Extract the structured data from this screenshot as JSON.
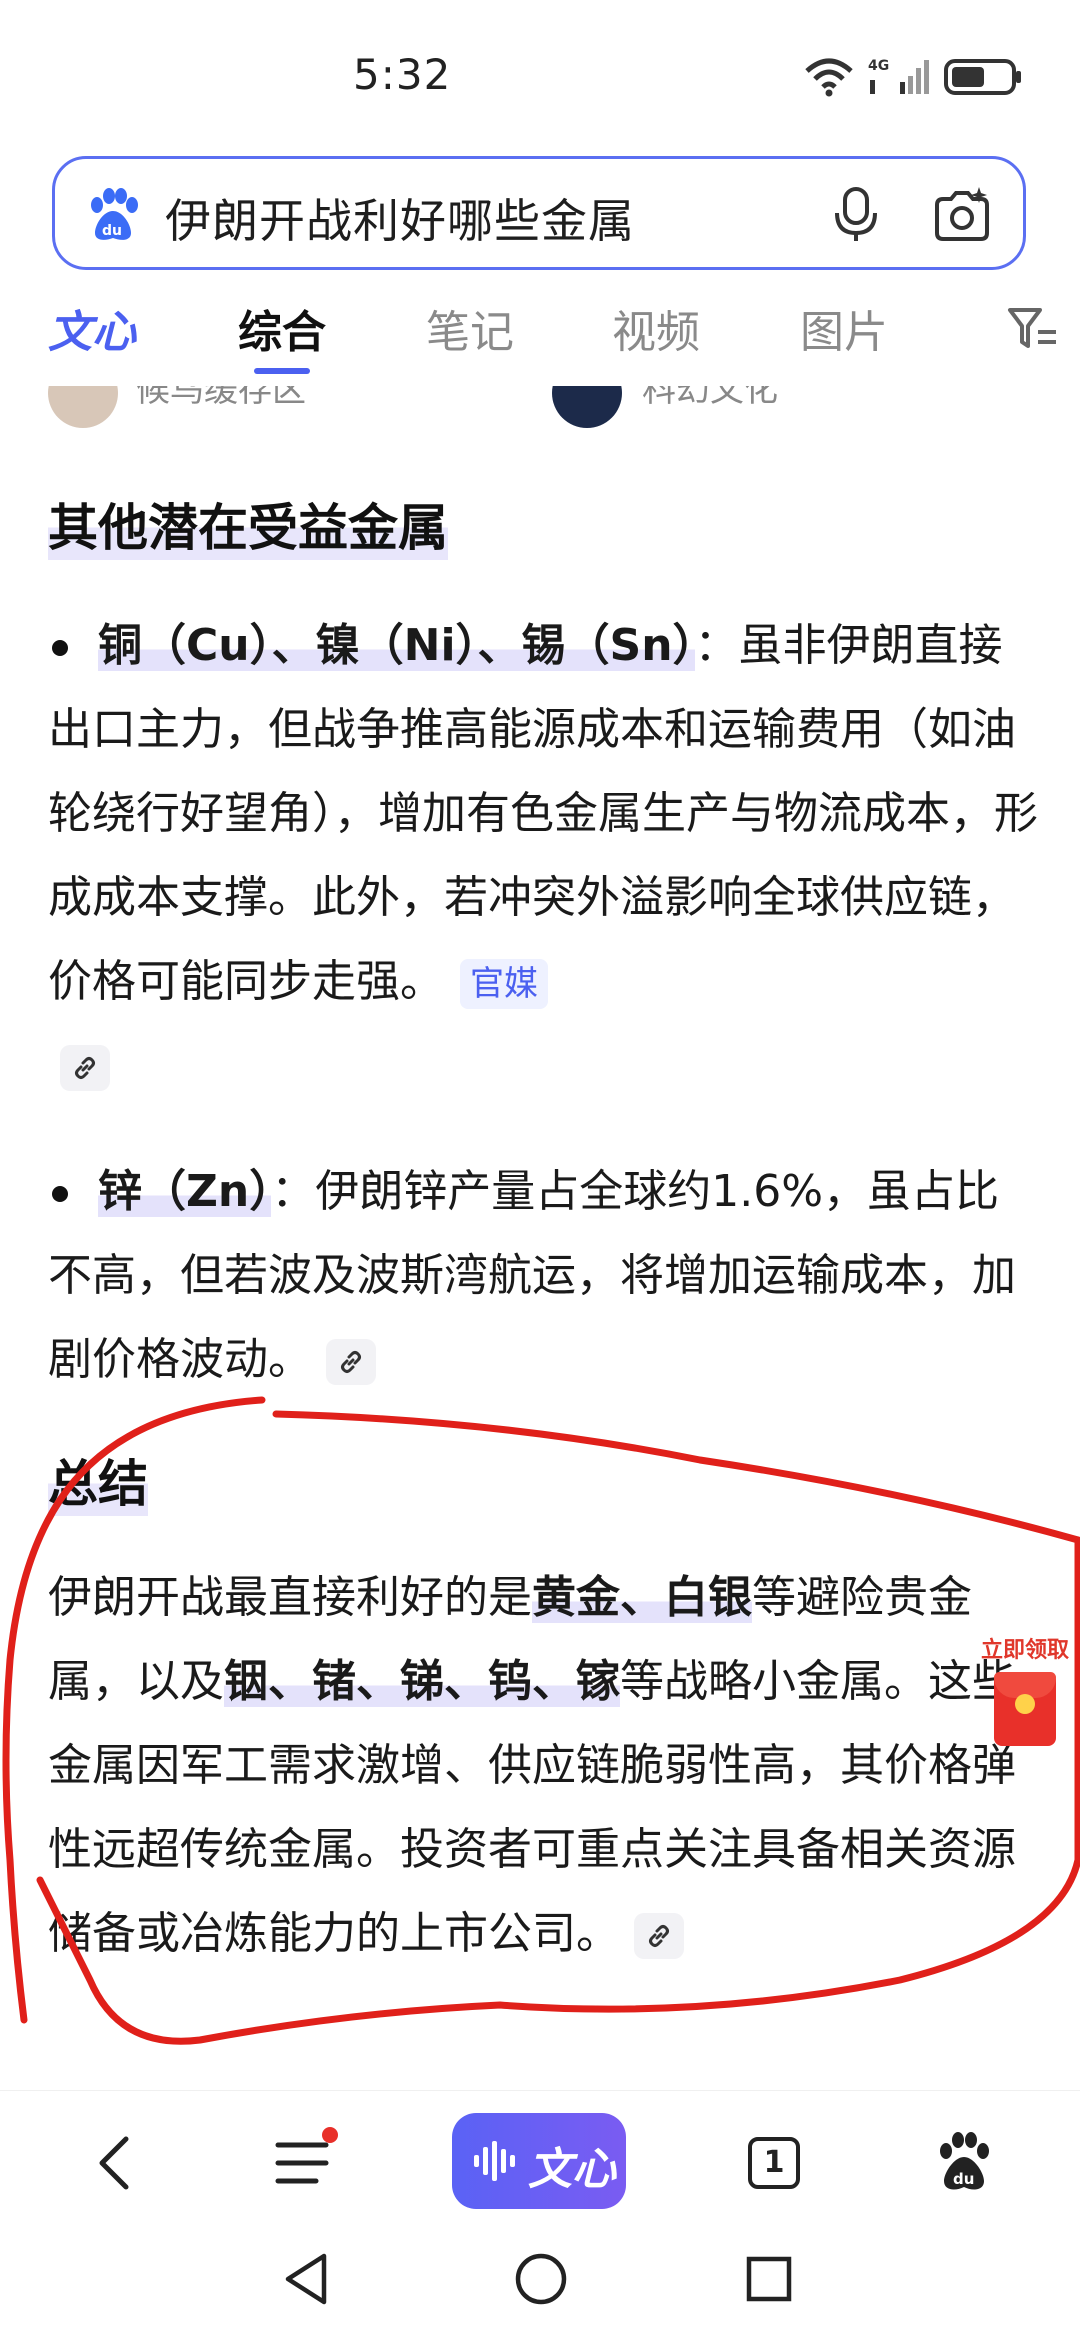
{
  "status_bar": {
    "time": "5:32",
    "network": "4G"
  },
  "search": {
    "query": "伊朗开战利好哪些金属"
  },
  "tabs": [
    {
      "label": "文心"
    },
    {
      "label": "综合"
    },
    {
      "label": "笔记"
    },
    {
      "label": "视频"
    },
    {
      "label": "图片"
    }
  ],
  "authors": [
    {
      "name": "候鸟缓存区"
    },
    {
      "name": "科幻文化"
    }
  ],
  "section1": {
    "title": "其他潜在受益金属",
    "bullet1": {
      "term": "铜（Cu）、镍（Ni）、锡（Sn）",
      "sep": "：",
      "text": "虽非伊朗直接出口主力，但战争推高能源成本和运输费用（如油轮绕行好望角），增加有色金属生产与物流成本，形成成本支撑。此外，若冲突外溢影响全球供应链，价格可能同步走强。",
      "tag": "官媒"
    },
    "bullet2": {
      "term": "锌（Zn）",
      "sep": "：",
      "text": "伊朗锌产量占全球约1.6%，虽占比不高，但若波及波斯湾航运，将增加运输成本，加剧价格波动。"
    }
  },
  "summary": {
    "title": "总结",
    "p_a": "伊朗开战最直接利好的是",
    "hl_a": "黄金、白银",
    "p_b": "等避险贵金属，以及",
    "hl_b": "铟、锗、锑、钨、镓",
    "p_c": "等战略小金属。这些金属因军工需求激增、供应链脆弱性高，其价格弹性远超传统金属。投资者可重点关注具备相关资源储备或冶炼能力的上市公司。"
  },
  "red_packet": {
    "label": "立即领取"
  },
  "toolbar": {
    "wenxin_label": "文心",
    "tabs_count": "1"
  },
  "colors": {
    "accent": "#4b60f0",
    "annotation_red": "#e0201a"
  }
}
